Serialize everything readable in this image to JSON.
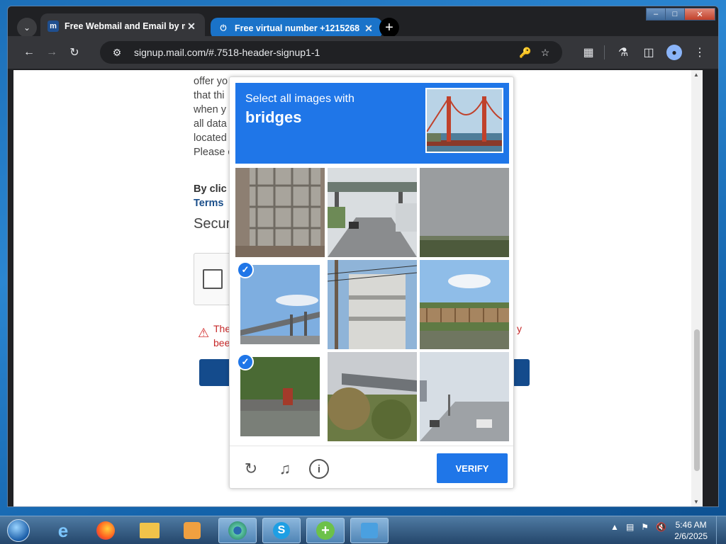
{
  "browser": {
    "tabs": [
      {
        "title": "Free Webmail and Email by mail.com",
        "favicon": "m",
        "active": true
      },
      {
        "title": "Free virtual number +1215268",
        "favicon": "power-icon",
        "active": false
      }
    ],
    "url": "signup.mail.com/#.7518-header-signup1-1"
  },
  "page": {
    "text_lines": [
      "offer yo",
      "that thi",
      "when y",
      "all data",
      "located",
      "Please c"
    ],
    "agree_prefix": "By clic",
    "terms_link": "Terms",
    "security_heading": "Secur",
    "warning_prefix": "The",
    "warning_second": "bee",
    "warning_tail": "y"
  },
  "captcha": {
    "prompt": "Select all images with",
    "subject": "bridges",
    "cells": [
      {
        "scene": "building-grille",
        "selected": false
      },
      {
        "scene": "highway-overpass",
        "selected": false
      },
      {
        "scene": "grey-sky-field",
        "selected": false
      },
      {
        "scene": "overpass-sky",
        "selected": true
      },
      {
        "scene": "apartment-building",
        "selected": false
      },
      {
        "scene": "railing-bridge-trees",
        "selected": false
      },
      {
        "scene": "bushes-bridge",
        "selected": true
      },
      {
        "scene": "bridge-foliage",
        "selected": false
      },
      {
        "scene": "city-road",
        "selected": false
      }
    ],
    "verify_label": "VERIFY",
    "accent": "#1f76e8"
  },
  "taskbar": {
    "time": "5:46 AM",
    "date": "2/6/2025"
  }
}
